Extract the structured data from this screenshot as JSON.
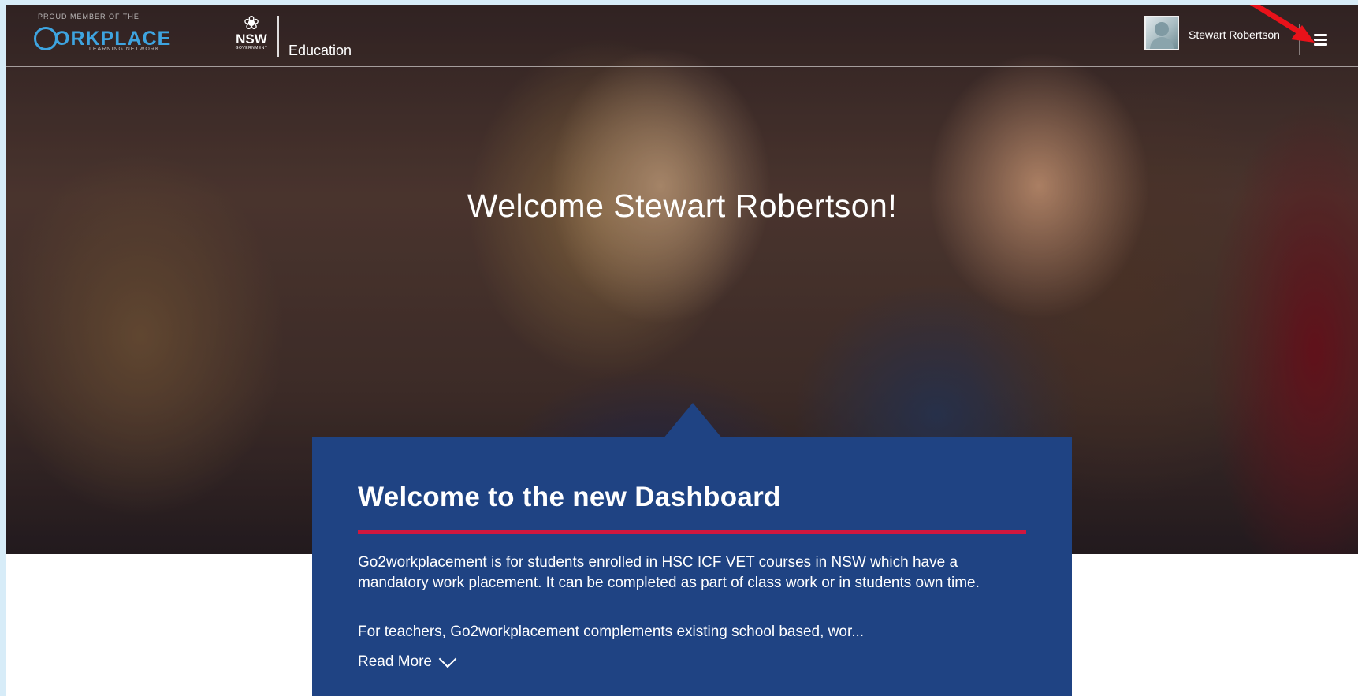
{
  "header": {
    "wpl_tagline": "PROUD MEMBER OF THE",
    "wpl_word": "ORKPLACE",
    "wpl_sub": "LEARNING NETWORK",
    "nsw_text": "NSW",
    "nsw_gov": "GOVERNMENT",
    "education_label": "Education",
    "user_name": "Stewart Robertson"
  },
  "hero": {
    "welcome": "Welcome Stewart Robertson!"
  },
  "card": {
    "title": "Welcome to the new Dashboard",
    "paragraph1": "Go2workplacement is for students enrolled in HSC ICF VET courses in NSW which have a mandatory work placement. It can be completed as part of class work or in students own time.",
    "paragraph2": "For teachers, Go2workplacement complements existing school based, wor...",
    "read_more": "Read More"
  },
  "colors": {
    "card_bg": "#1f4383",
    "accent_red": "#d0173e",
    "logo_blue": "#3ea4e0"
  }
}
